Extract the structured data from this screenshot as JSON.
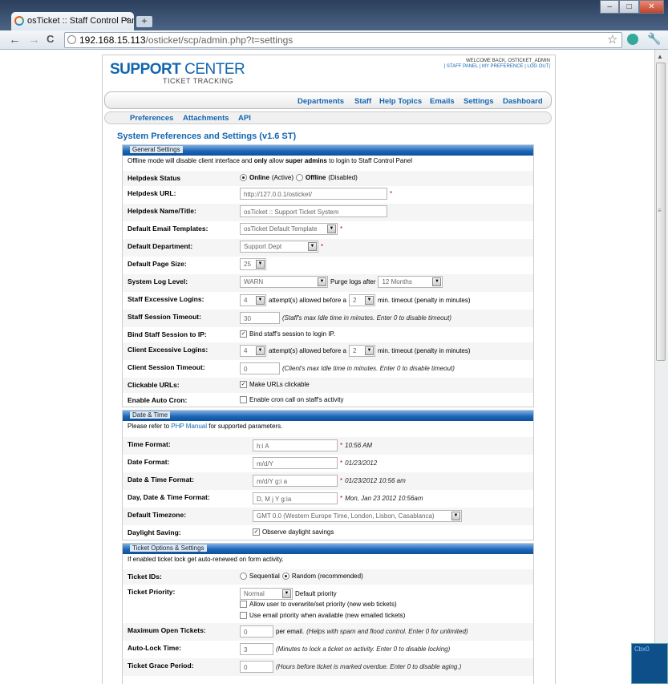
{
  "browser": {
    "tab_title": "osTicket :: Staff Control Pan",
    "tab_close": "×",
    "new_tab": "+",
    "url_host": "192.168.15.113",
    "url_rest": "/osticket/scp/admin.php?t=settings",
    "back": "←",
    "forward": "→",
    "reload": "C",
    "star": "☆",
    "wrench": "🔧",
    "win_min": "–",
    "win_max": "□",
    "win_close": "✕",
    "corner_widget": "Cbx0"
  },
  "header": {
    "logo_title_a": "SUPPORT",
    "logo_title_b": " CENTER",
    "logo_subtitle": "TICKET TRACKING",
    "welcome": "WELCOME BACK, OSTICKET_ADMIN",
    "links": "| STAFF PANEL | MY PREFERENCE | LOG OUT|"
  },
  "nav": [
    "Departments",
    "Staff",
    "Help Topics",
    "Emails",
    "Settings",
    "Dashboard"
  ],
  "subnav": [
    "Preferences",
    "Attachments",
    "API"
  ],
  "page_title": "System Preferences and Settings  (v1.6 ST)",
  "general": {
    "title": "General Settings",
    "note_a": "Offline mode will disable client interface and ",
    "note_b": "only",
    "note_c": " allow ",
    "note_d": "super admins",
    "note_e": " to login to Staff Control Panel",
    "status_label": "Helpdesk Status",
    "status_online": "Online",
    "status_online_note": " (Active)",
    "status_offline": "Offline",
    "status_offline_note": " (Disabled)",
    "url_label": "Helpdesk URL:",
    "url_value": "http://127.0.0.1/osticket/",
    "name_label": "Helpdesk Name/Title:",
    "name_value": "osTicket :: Support Ticket System",
    "tpl_label": "Default Email Templates:",
    "tpl_value": "osTicket Default Template",
    "dept_label": "Default Department:",
    "dept_value": "Support Dept",
    "pagesize_label": "Default Page Size:",
    "pagesize_value": "25",
    "log_label": "System Log Level:",
    "log_value": "WARN",
    "purge_label": "Purge logs after",
    "purge_value": "12 Months",
    "staff_login_label": "Staff Excessive Logins:",
    "staff_login_value": "4",
    "attempts_text": "attempt(s) allowed  before a",
    "staff_timeout_value": "2",
    "timeout_text": "min. timeout (penalty in minutes)",
    "staff_session_label": "Staff Session Timeout:",
    "staff_session_value": "30",
    "staff_session_hint": "(Staff's max Idle time in minutes. Enter 0 to disable timeout)",
    "bind_label": "Bind Staff Session to IP:",
    "bind_text": "Bind staff's session to login IP.",
    "client_login_label": "Client Excessive Logins:",
    "client_login_value": "4",
    "client_timeout_value": "2",
    "client_session_label": "Client Session Timeout:",
    "client_session_value": "0",
    "client_session_hint": "(Client's max Idle time in minutes. Enter 0 to disable timeout)",
    "urls_label": "Clickable URLs:",
    "urls_text": "Make URLs clickable",
    "cron_label": "Enable Auto Cron:",
    "cron_text": "Enable cron call on staff's activity"
  },
  "datetime": {
    "title": "Date & Time",
    "note_a": "Please refer to ",
    "note_link": "PHP Manual",
    "note_b": " for supported parameters.",
    "time_label": "Time Format:",
    "time_value": "h:i A",
    "time_example": "10:56 AM",
    "date_label": "Date Format:",
    "date_value": "m/d/Y",
    "date_example": "01/23/2012",
    "dt_label": "Date & Time Format:",
    "dt_value": "m/d/Y g:i a",
    "dt_example": "01/23/2012 10:56 am",
    "ddt_label": "Day, Date & Time Format:",
    "ddt_value": "D, M j Y g:ia",
    "ddt_example": "Mon, Jan 23 2012 10:56am",
    "tz_label": "Default Timezone:",
    "tz_value": "GMT 0.0 (Western Europe Time, London, Lisbon, Casablanca)",
    "dst_label": "Daylight Saving:",
    "dst_text": "Observe daylight savings",
    "asterisk": "*"
  },
  "tickets": {
    "title": "Ticket Options & Settings",
    "note": "If enabled ticket lock get auto-renewed on form activity.",
    "ids_label": "Ticket IDs:",
    "ids_seq": "Sequential",
    "ids_rand": "Random  (recommended)",
    "priority_label": "Ticket Priority:",
    "priority_value": "Normal",
    "priority_default": "Default priority",
    "priority_web": "Allow user to overwrite/set priority (new web tickets)",
    "priority_email": "Use email priority when available (new emailed tickets)",
    "maxopen_label": "Maximum Open Tickets:",
    "maxopen_value": "0",
    "maxopen_unit": "per email.",
    "maxopen_hint": "(Helps with spam and flood control. Enter 0 for unlimited)",
    "lock_label": "Auto-Lock Time:",
    "lock_value": "3",
    "lock_hint": "(Minutes to lock a ticket on activity. Enter 0 to disable locking)",
    "grace_label": "Ticket Grace Period:",
    "grace_value": "0",
    "grace_hint": "(Hours before ticket is marked overdue. Enter 0 to disable aging.)"
  }
}
